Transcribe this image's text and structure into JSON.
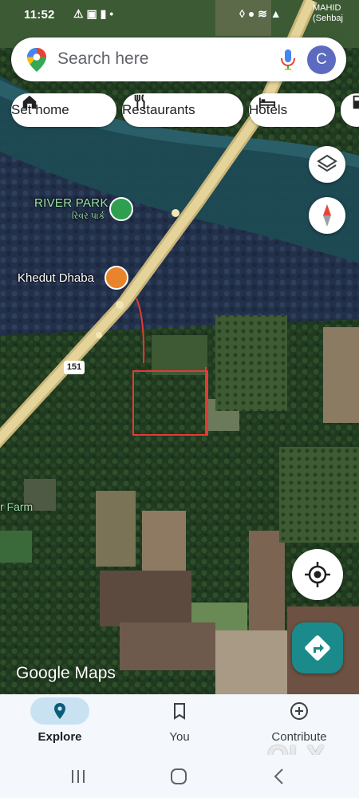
{
  "status_bar": {
    "time": "11:52",
    "left_icons": [
      "warning-icon",
      "image-icon",
      "battery-saver-icon",
      "dot-icon"
    ],
    "right_icons": [
      "mute-icon",
      "location-icon",
      "wifi-icon",
      "signal-icon"
    ],
    "carrier_text_line1": "MAHID",
    "carrier_text_line2": "(Sehbaj"
  },
  "search": {
    "placeholder": "Search here",
    "avatar_letter": "C"
  },
  "chips": [
    {
      "label": "Set home",
      "icon": "home-icon"
    },
    {
      "label": "Restaurants",
      "icon": "restaurant-icon"
    },
    {
      "label": "Hotels",
      "icon": "hotel-icon"
    },
    {
      "label": "",
      "icon": "gas-station-icon"
    }
  ],
  "map": {
    "labels": {
      "river_park": "RIVER PARK",
      "river_park_local": "રિવર પાર્ક",
      "khedut_dhaba": "Khedut Dhaba",
      "farm": "r Farm",
      "route_number": "151"
    },
    "watermark": "Google Maps"
  },
  "bottom_nav": [
    {
      "label": "Explore",
      "icon": "explore-pin-icon",
      "selected": true
    },
    {
      "label": "You",
      "icon": "bookmark-icon",
      "selected": false
    },
    {
      "label": "Contribute",
      "icon": "add-circle-icon",
      "selected": false
    }
  ],
  "overlay_watermark": "OLX",
  "colors": {
    "accent_teal": "#1b8a8a",
    "avatar_bg": "#5c6bc0",
    "selected_pill": "#c8e2f2",
    "annotation_red": "#e53935"
  }
}
